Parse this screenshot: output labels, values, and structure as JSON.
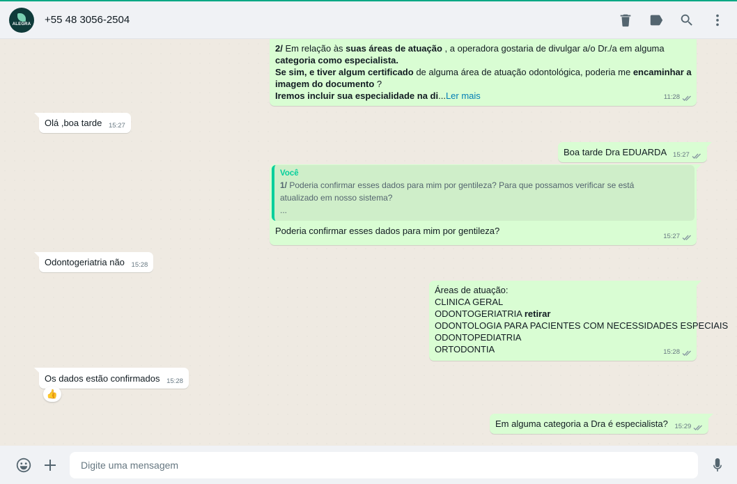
{
  "header": {
    "contact_name": "+55 48 3056-2504",
    "avatar_text": "ALEGRA",
    "icons": [
      "delete-icon",
      "label-icon",
      "search-icon",
      "menu-icon"
    ]
  },
  "messages": [
    {
      "id": "m1",
      "direction": "out",
      "lines": [
        [
          {
            "t": "2/",
            "b": true
          },
          {
            "t": " Em relação às "
          },
          {
            "t": "suas áreas de atuação",
            "b": true
          },
          {
            "t": " , a operadora gostaria de divulgar a/o Dr./a em alguma"
          }
        ],
        [
          {
            "t": "categoria como especialista.",
            "b": true
          }
        ],
        [
          {
            "t": "Se sim, e tiver algum certificado",
            "b": true
          },
          {
            "t": " de alguma área de atuação odontológica, poderia me "
          },
          {
            "t": "encaminhar a",
            "b": true
          }
        ],
        [
          {
            "t": "imagem do documento",
            "b": true
          },
          {
            "t": " ?"
          }
        ],
        [
          {
            "t": "Iremos incluir sua especialidade na di",
            "b": true
          },
          {
            "t": "..."
          }
        ]
      ],
      "read_more": "Ler mais",
      "time": "11:28"
    },
    {
      "id": "m2",
      "direction": "in",
      "text": "Olá ,boa tarde",
      "time": "15:27"
    },
    {
      "id": "m3",
      "direction": "out",
      "text": "Boa tarde Dra EDUARDA",
      "time": "15:27"
    },
    {
      "id": "m4",
      "direction": "out",
      "quote": {
        "author": "Você",
        "prefix": "1/",
        "line1": " Poderia confirmar esses dados para mim por gentileza? Para que possamos verificar se está",
        "line2": "atualizado em nosso sistema?",
        "line3": "..."
      },
      "text": "Poderia confirmar esses dados para mim por gentileza?",
      "time": "15:27"
    },
    {
      "id": "m5",
      "direction": "in",
      "text": "Odontogeriatria não",
      "time": "15:28"
    },
    {
      "id": "m6",
      "direction": "out",
      "title": "Áreas de atuação:",
      "item1": "CLINICA GERAL",
      "item2": "ODONTOGERIATRIA",
      "item2_bold": "retirar",
      "item3": "ODONTOLOGIA PARA PACIENTES COM NECESSIDADES ESPECIAIS",
      "item4": "ODONTOPEDIATRIA",
      "item5": "ORTODONTIA",
      "time": "15:28"
    },
    {
      "id": "m7",
      "direction": "in",
      "text": "Os dados estão confirmados",
      "time": "15:28",
      "reaction": "👍"
    },
    {
      "id": "m8",
      "direction": "out",
      "text": "Em alguma categoria a Dra é especialista?",
      "time": "15:29"
    }
  ],
  "footer": {
    "placeholder": "Digite uma mensagem",
    "icons": [
      "emoji-icon",
      "attach-plus-icon",
      "microphone-icon"
    ]
  },
  "colors": {
    "outgoing_bubble": "#d9fdd3",
    "incoming_bubble": "#ffffff",
    "chat_background": "#efeae2",
    "accent": "#00a884",
    "quote_author": "#06cf9c",
    "link": "#027eb5"
  }
}
